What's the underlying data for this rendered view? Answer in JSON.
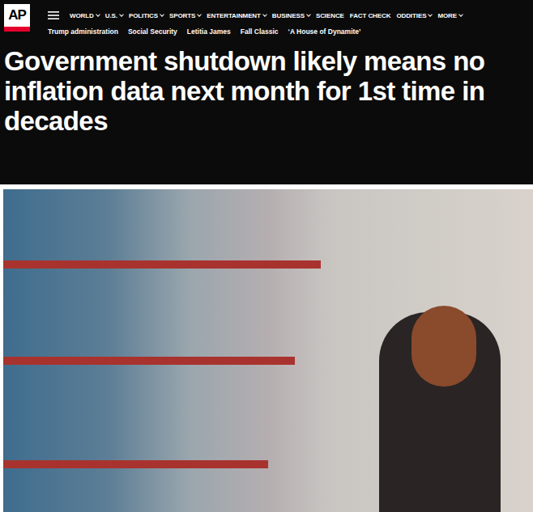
{
  "site": {
    "logo": "AP"
  },
  "nav": [
    {
      "label": "WORLD",
      "has_menu": true
    },
    {
      "label": "U.S.",
      "has_menu": true
    },
    {
      "label": "POLITICS",
      "has_menu": true
    },
    {
      "label": "SPORTS",
      "has_menu": true
    },
    {
      "label": "ENTERTAINMENT",
      "has_menu": true
    },
    {
      "label": "BUSINESS",
      "has_menu": true
    },
    {
      "label": "SCIENCE",
      "has_menu": false
    },
    {
      "label": "FACT CHECK",
      "has_menu": false
    },
    {
      "label": "ODDITIES",
      "has_menu": true
    },
    {
      "label": "MORE",
      "has_menu": true
    }
  ],
  "trending": [
    "Trump administration",
    "Social Security",
    "Letitia James",
    "Fall Classic",
    "‘A House of Dynamite’"
  ],
  "article": {
    "headline": "Government shutdown likely means no inflation data next month for 1st time in decades"
  }
}
